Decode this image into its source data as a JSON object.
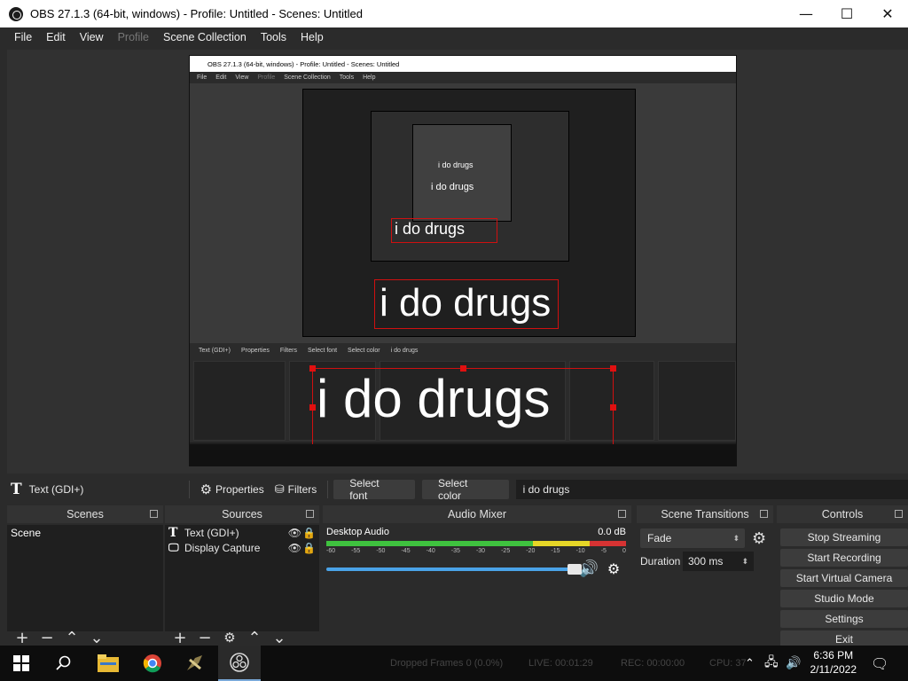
{
  "window": {
    "title": "OBS 27.1.3 (64-bit, windows) - Profile: Untitled - Scenes: Untitled",
    "minimize": "—",
    "maximize": "☐",
    "close": "✕"
  },
  "menu": [
    "File",
    "Edit",
    "View",
    "Profile",
    "Scene Collection",
    "Tools",
    "Help"
  ],
  "preview": {
    "caption": "i do drugs",
    "mini_title": "OBS 27.1.3 (64-bit, windows) - Profile: Untitled - Scenes: Untitled"
  },
  "source_toolbar": {
    "source_name": "Text (GDI+)",
    "properties": "Properties",
    "filters": "Filters",
    "select_font": "Select font",
    "select_color": "Select color",
    "text_value": "i do drugs"
  },
  "docks": {
    "scenes": {
      "title": "Scenes",
      "items": [
        "Scene"
      ]
    },
    "sources": {
      "title": "Sources",
      "items": [
        "Text (GDI+)",
        "Display Capture"
      ]
    },
    "mixer": {
      "title": "Audio Mixer",
      "channel": "Desktop Audio",
      "level": "0.0 dB",
      "scale": [
        "-60",
        "-55",
        "-50",
        "-45",
        "-40",
        "-35",
        "-30",
        "-25",
        "-20",
        "-15",
        "-10",
        "-5",
        "0"
      ]
    },
    "transitions": {
      "title": "Scene Transitions",
      "selected": "Fade",
      "duration_label": "Duration",
      "duration_value": "300 ms"
    },
    "controls": {
      "title": "Controls",
      "buttons": [
        "Stop Streaming",
        "Start Recording",
        "Start Virtual Camera",
        "Studio Mode",
        "Settings",
        "Exit"
      ]
    }
  },
  "statusbar": {
    "dropped": "Dropped Frames 0 (0.0%)",
    "live": "LIVE: 00:01:29",
    "rec": "REC: 00:00:00",
    "cpu": "CPU: 37"
  },
  "taskbar": {
    "time": "6:36 PM",
    "date": "2/11/2022"
  },
  "icons": {
    "start": "windows-start-icon",
    "search": "search-icon",
    "explorer": "file-explorer-icon",
    "chrome": "chrome-icon",
    "app": "app-icon",
    "obs": "obs-icon"
  }
}
